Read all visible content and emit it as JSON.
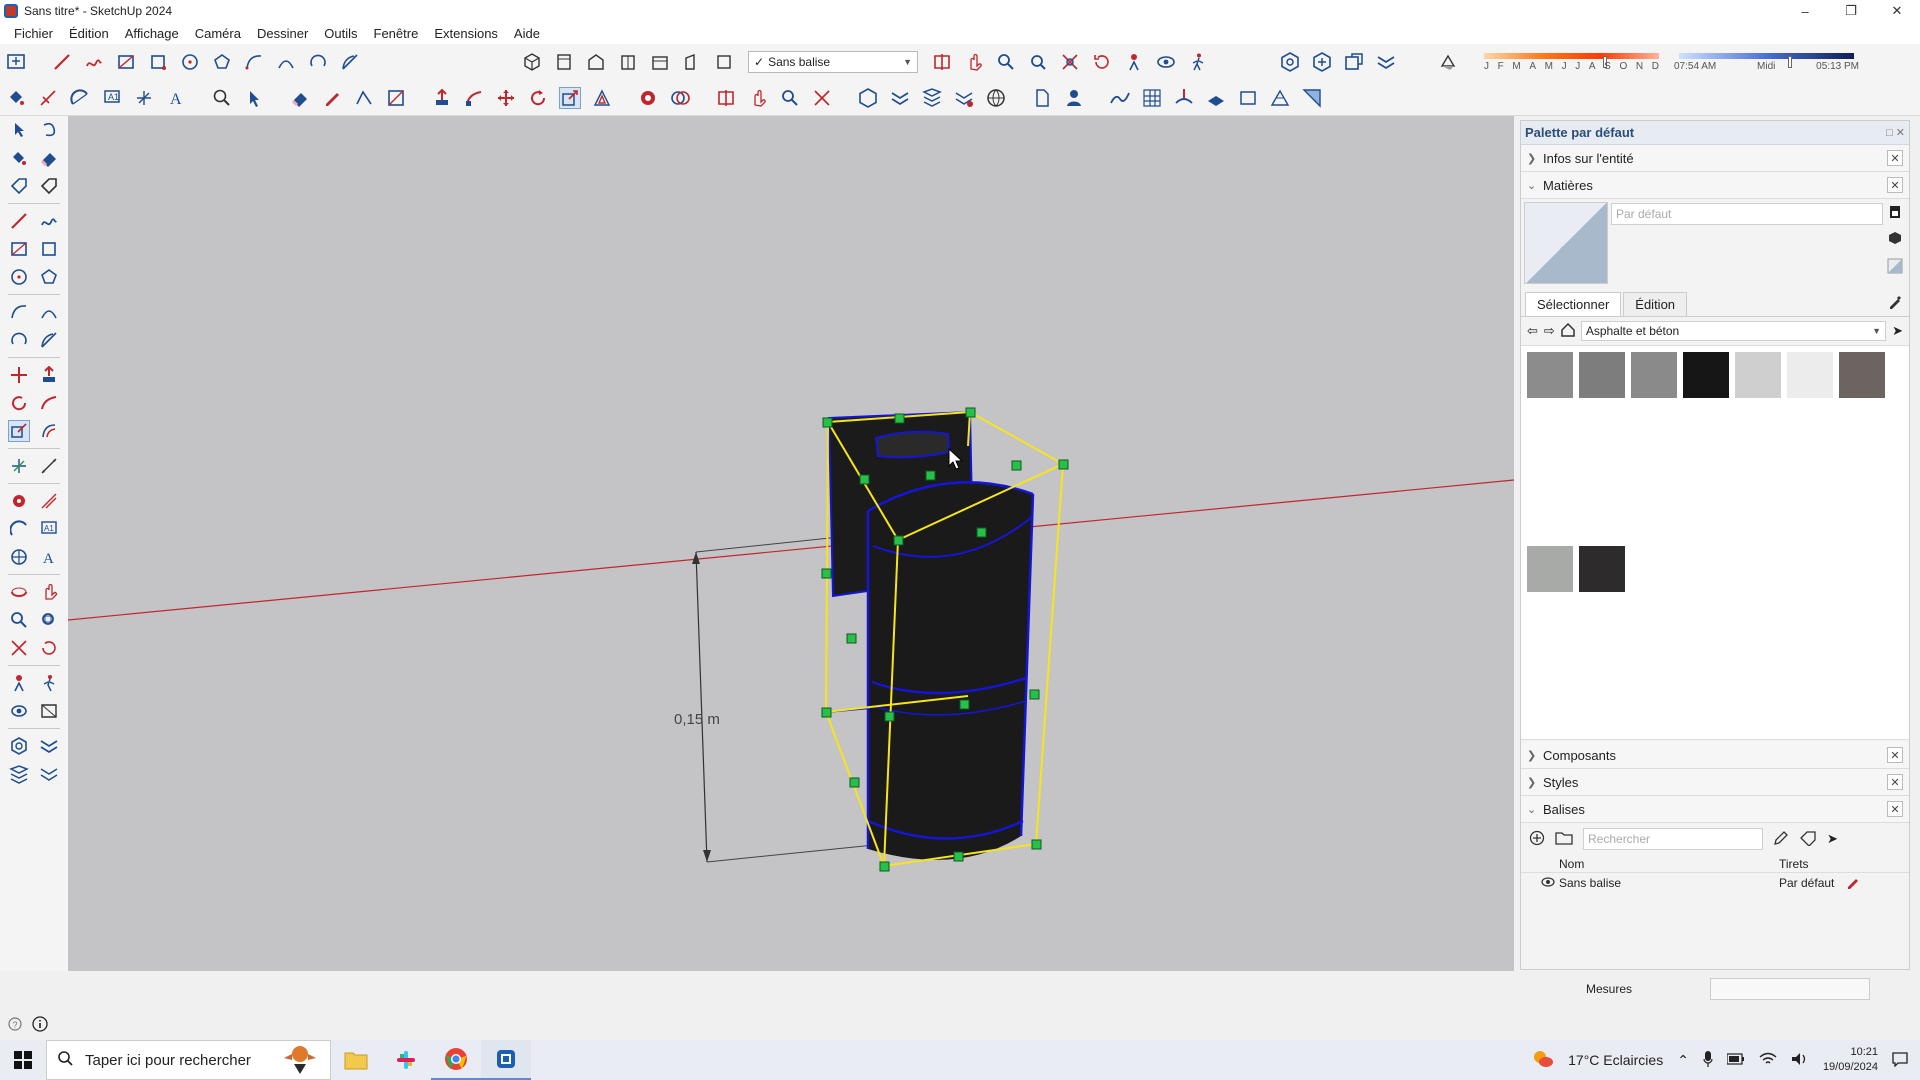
{
  "window": {
    "title": "Sans titre* - SketchUp 2024"
  },
  "menu": [
    "Fichier",
    "Édition",
    "Affichage",
    "Caméra",
    "Dessiner",
    "Outils",
    "Fenêtre",
    "Extensions",
    "Aide"
  ],
  "toolbar": {
    "tag_select": "Sans balise",
    "shadow_months": [
      "J",
      "F",
      "M",
      "A",
      "M",
      "J",
      "J",
      "A",
      "S",
      "O",
      "N",
      "D"
    ],
    "shadow_month_level": 0.68,
    "shadow_time_level": 0.62,
    "time_start": "07:54 AM",
    "time_mid": "Midi",
    "time_end": "05:13 PM"
  },
  "viewport": {
    "dimension_label": "0,15 m",
    "colors": {
      "background": "#c4c4c6",
      "selection": "#f5e51a",
      "grip": "#27c04a",
      "edge_highlight": "#1515d8",
      "body": "#1c1c1c",
      "red_axis": "#c0272d"
    }
  },
  "panel": {
    "title": "Palette par défaut",
    "sections": {
      "entity_info": "Infos sur l'entité",
      "materials": "Matières",
      "components": "Composants",
      "styles": "Styles",
      "tags": "Balises"
    },
    "materials": {
      "name_placeholder": "Par défaut",
      "tabs": [
        "Sélectionner",
        "Édition"
      ],
      "library": "Asphalte et béton",
      "swatches": [
        "#8c8c8c",
        "#7d7d7d",
        "#8a8a8a",
        "#161616",
        "#cfcfcf",
        "#ececec",
        "#6b6460",
        "#a7aaa7",
        "#2e2b2d"
      ]
    },
    "tags": {
      "search_placeholder": "Rechercher",
      "columns": [
        "Nom",
        "Tirets"
      ],
      "rows": [
        {
          "name": "Sans balise",
          "dash": "Par défaut"
        }
      ]
    }
  },
  "measures": {
    "label": "Mesures"
  },
  "taskbar": {
    "search_placeholder": "Taper ici pour rechercher",
    "weather": "17°C  Eclaircies",
    "time": "10:21",
    "date": "19/09/2024"
  }
}
